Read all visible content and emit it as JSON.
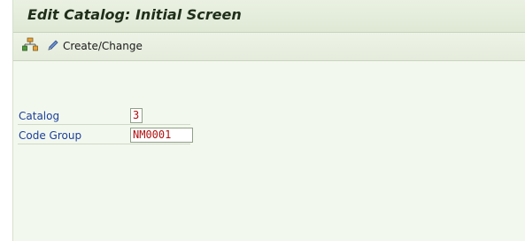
{
  "title": "Edit Catalog: Initial Screen",
  "toolbar": {
    "hierarchy_icon": "hierarchy-tree-icon",
    "create_change_icon": "pencil-icon",
    "create_change_label": "Create/Change"
  },
  "form": {
    "catalog": {
      "label": "Catalog",
      "value": "3"
    },
    "code_group": {
      "label": "Code Group",
      "value": "NM0001"
    }
  },
  "colors": {
    "window_bg": "#f3f8ee",
    "label_text": "#1b3f9c",
    "field_text": "#b01010"
  }
}
